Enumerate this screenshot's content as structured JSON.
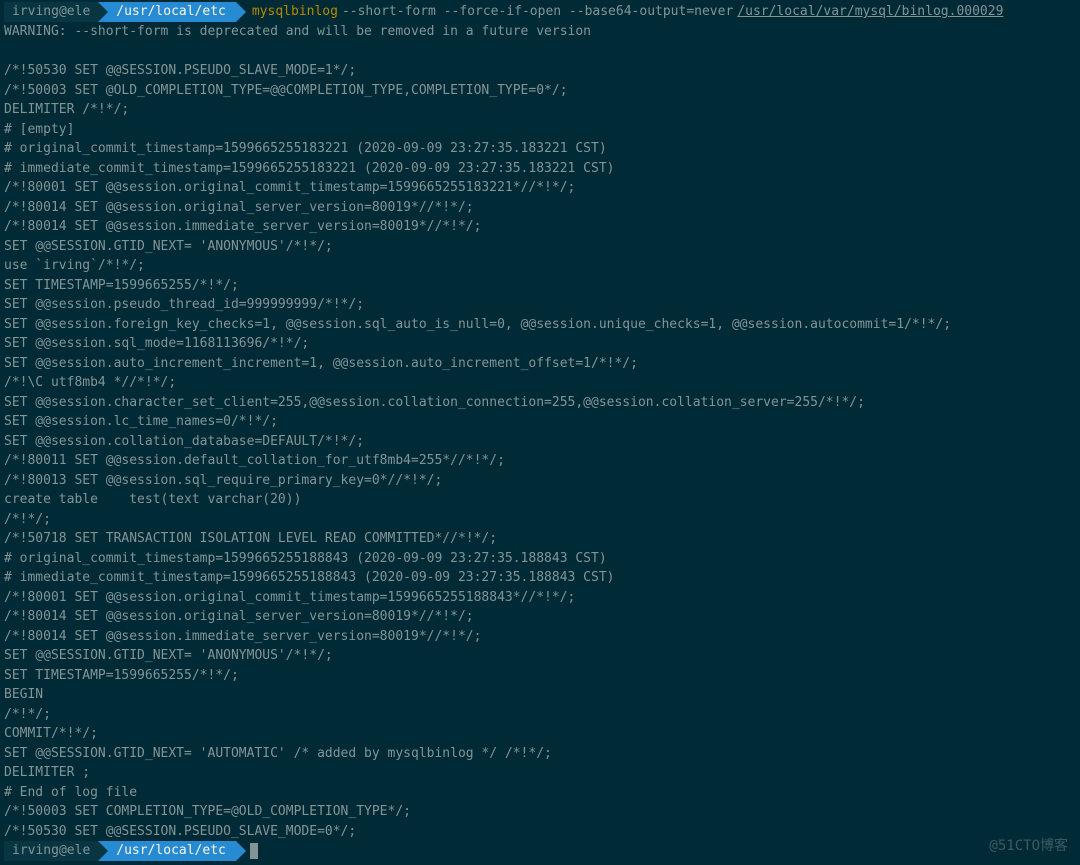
{
  "prompt1": {
    "user": "irving@ele",
    "path": "/usr/local/etc",
    "command": "mysqlbinlog",
    "args": "--short-form --force-if-open --base64-output=never",
    "file": "/usr/local/var/mysql/binlog.000029"
  },
  "output": [
    "WARNING: --short-form is deprecated and will be removed in a future version",
    "",
    "/*!50530 SET @@SESSION.PSEUDO_SLAVE_MODE=1*/;",
    "/*!50003 SET @OLD_COMPLETION_TYPE=@@COMPLETION_TYPE,COMPLETION_TYPE=0*/;",
    "DELIMITER /*!*/;",
    "# [empty]",
    "# original_commit_timestamp=1599665255183221 (2020-09-09 23:27:35.183221 CST)",
    "# immediate_commit_timestamp=1599665255183221 (2020-09-09 23:27:35.183221 CST)",
    "/*!80001 SET @@session.original_commit_timestamp=1599665255183221*//*!*/;",
    "/*!80014 SET @@session.original_server_version=80019*//*!*/;",
    "/*!80014 SET @@session.immediate_server_version=80019*//*!*/;",
    "SET @@SESSION.GTID_NEXT= 'ANONYMOUS'/*!*/;",
    "use `irving`/*!*/;",
    "SET TIMESTAMP=1599665255/*!*/;",
    "SET @@session.pseudo_thread_id=999999999/*!*/;",
    "SET @@session.foreign_key_checks=1, @@session.sql_auto_is_null=0, @@session.unique_checks=1, @@session.autocommit=1/*!*/;",
    "SET @@session.sql_mode=1168113696/*!*/;",
    "SET @@session.auto_increment_increment=1, @@session.auto_increment_offset=1/*!*/;",
    "/*!\\C utf8mb4 *//*!*/;",
    "SET @@session.character_set_client=255,@@session.collation_connection=255,@@session.collation_server=255/*!*/;",
    "SET @@session.lc_time_names=0/*!*/;",
    "SET @@session.collation_database=DEFAULT/*!*/;",
    "/*!80011 SET @@session.default_collation_for_utf8mb4=255*//*!*/;",
    "/*!80013 SET @@session.sql_require_primary_key=0*//*!*/;",
    "create table    test(text varchar(20))",
    "/*!*/;",
    "/*!50718 SET TRANSACTION ISOLATION LEVEL READ COMMITTED*//*!*/;",
    "# original_commit_timestamp=1599665255188843 (2020-09-09 23:27:35.188843 CST)",
    "# immediate_commit_timestamp=1599665255188843 (2020-09-09 23:27:35.188843 CST)",
    "/*!80001 SET @@session.original_commit_timestamp=1599665255188843*//*!*/;",
    "/*!80014 SET @@session.original_server_version=80019*//*!*/;",
    "/*!80014 SET @@session.immediate_server_version=80019*//*!*/;",
    "SET @@SESSION.GTID_NEXT= 'ANONYMOUS'/*!*/;",
    "SET TIMESTAMP=1599665255/*!*/;",
    "BEGIN",
    "/*!*/;",
    "COMMIT/*!*/;",
    "SET @@SESSION.GTID_NEXT= 'AUTOMATIC' /* added by mysqlbinlog */ /*!*/;",
    "DELIMITER ;",
    "# End of log file",
    "/*!50003 SET COMPLETION_TYPE=@OLD_COMPLETION_TYPE*/;",
    "/*!50530 SET @@SESSION.PSEUDO_SLAVE_MODE=0*/;"
  ],
  "prompt2": {
    "user": "irving@ele",
    "path": "/usr/local/etc"
  },
  "watermark": "@51CTO博客"
}
